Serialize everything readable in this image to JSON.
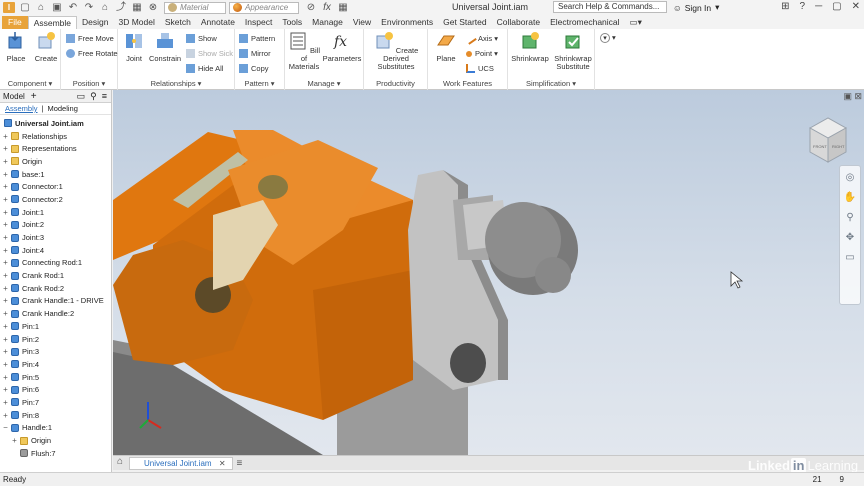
{
  "titlebar": {
    "material_placeholder": "Material",
    "appearance_placeholder": "Appearance",
    "document_title": "Universal Joint.iam",
    "search_placeholder": "Search Help & Commands...",
    "signin_label": "Sign In",
    "help_label": "?"
  },
  "tabs": [
    {
      "label": "File"
    },
    {
      "label": "Assemble"
    },
    {
      "label": "Design"
    },
    {
      "label": "3D Model"
    },
    {
      "label": "Sketch"
    },
    {
      "label": "Annotate"
    },
    {
      "label": "Inspect"
    },
    {
      "label": "Tools"
    },
    {
      "label": "Manage"
    },
    {
      "label": "View"
    },
    {
      "label": "Environments"
    },
    {
      "label": "Get Started"
    },
    {
      "label": "Collaborate"
    },
    {
      "label": "Electromechanical"
    }
  ],
  "ribbon": {
    "component": {
      "title": "Component ▾",
      "place": "Place",
      "create": "Create"
    },
    "position": {
      "title": "Position ▾",
      "free_move": "Free Move",
      "free_rotate": "Free Rotate"
    },
    "relationships": {
      "title": "Relationships ▾",
      "joint": "Joint",
      "constrain": "Constrain",
      "show": "Show",
      "show_sick": "Show Sick",
      "hide_all": "Hide All"
    },
    "pattern": {
      "title": "Pattern ▾",
      "pattern": "Pattern",
      "mirror": "Mirror",
      "copy": "Copy"
    },
    "manage": {
      "title": "Manage ▾",
      "bom_line1": "Bill of",
      "bom_line2": "Materials",
      "parameters": "Parameters"
    },
    "productivity": {
      "title": "Productivity",
      "cds_line1": "Create Derived",
      "cds_line2": "Substitutes"
    },
    "work_features": {
      "title": "Work Features",
      "plane": "Plane",
      "axis": "Axis ▾",
      "point": "Point ▾",
      "ucs": "UCS"
    },
    "simplification": {
      "title": "Simplification ▾",
      "shrinkwrap": "Shrinkwrap",
      "sws_line1": "Shrinkwrap",
      "sws_line2": "Substitute"
    }
  },
  "browser": {
    "title": "Model",
    "tab_assembly": "Assembly",
    "tab_modeling": "Modeling",
    "root": "Universal Joint.iam",
    "items": [
      {
        "label": "Relationships",
        "kind": "folder",
        "toggle": "+",
        "indent": 0
      },
      {
        "label": "Representations",
        "kind": "folder",
        "toggle": "+",
        "indent": 0
      },
      {
        "label": "Origin",
        "kind": "folder",
        "toggle": "+",
        "indent": 0
      },
      {
        "label": "base:1",
        "kind": "part",
        "toggle": "+",
        "indent": 0
      },
      {
        "label": "Connector:1",
        "kind": "part",
        "toggle": "+",
        "indent": 0
      },
      {
        "label": "Connector:2",
        "kind": "part",
        "toggle": "+",
        "indent": 0
      },
      {
        "label": "Joint:1",
        "kind": "part",
        "toggle": "+",
        "indent": 0
      },
      {
        "label": "Joint:2",
        "kind": "part",
        "toggle": "+",
        "indent": 0
      },
      {
        "label": "Joint:3",
        "kind": "part",
        "toggle": "+",
        "indent": 0
      },
      {
        "label": "Joint:4",
        "kind": "part",
        "toggle": "+",
        "indent": 0
      },
      {
        "label": "Connecting Rod:1",
        "kind": "part",
        "toggle": "+",
        "indent": 0
      },
      {
        "label": "Crank Rod:1",
        "kind": "part",
        "toggle": "+",
        "indent": 0
      },
      {
        "label": "Crank Rod:2",
        "kind": "part",
        "toggle": "+",
        "indent": 0
      },
      {
        "label": "Crank Handle:1 - DRIVE",
        "kind": "part",
        "toggle": "+",
        "indent": 0
      },
      {
        "label": "Crank Handle:2",
        "kind": "part",
        "toggle": "+",
        "indent": 0
      },
      {
        "label": "Pin:1",
        "kind": "part",
        "toggle": "+",
        "indent": 0
      },
      {
        "label": "Pin:2",
        "kind": "part",
        "toggle": "+",
        "indent": 0
      },
      {
        "label": "Pin:3",
        "kind": "part",
        "toggle": "+",
        "indent": 0
      },
      {
        "label": "Pin:4",
        "kind": "part",
        "toggle": "+",
        "indent": 0
      },
      {
        "label": "Pin:5",
        "kind": "part",
        "toggle": "+",
        "indent": 0
      },
      {
        "label": "Pin:6",
        "kind": "part",
        "toggle": "+",
        "indent": 0
      },
      {
        "label": "Pin:7",
        "kind": "part",
        "toggle": "+",
        "indent": 0
      },
      {
        "label": "Pin:8",
        "kind": "part",
        "toggle": "+",
        "indent": 0
      },
      {
        "label": "Handle:1",
        "kind": "part",
        "toggle": "−",
        "indent": 0
      },
      {
        "label": "Origin",
        "kind": "folder",
        "toggle": "+",
        "indent": 1
      },
      {
        "label": "Flush:7",
        "kind": "constraint",
        "toggle": "",
        "indent": 1
      }
    ]
  },
  "viewcube": {
    "front": "FRONT",
    "right": "RIGHT"
  },
  "doc_tab": "Universal Joint.iam",
  "doc_tab_close": "✕",
  "status": {
    "text": "Ready",
    "num1": "21",
    "num2": "9"
  },
  "watermark": {
    "part1": "Linked",
    "part2": "in",
    "part3": "Learning"
  },
  "colors": {
    "accent": "#e8a33a",
    "orange_part": "#e0770f",
    "gray_part": "#a8a8a8"
  }
}
